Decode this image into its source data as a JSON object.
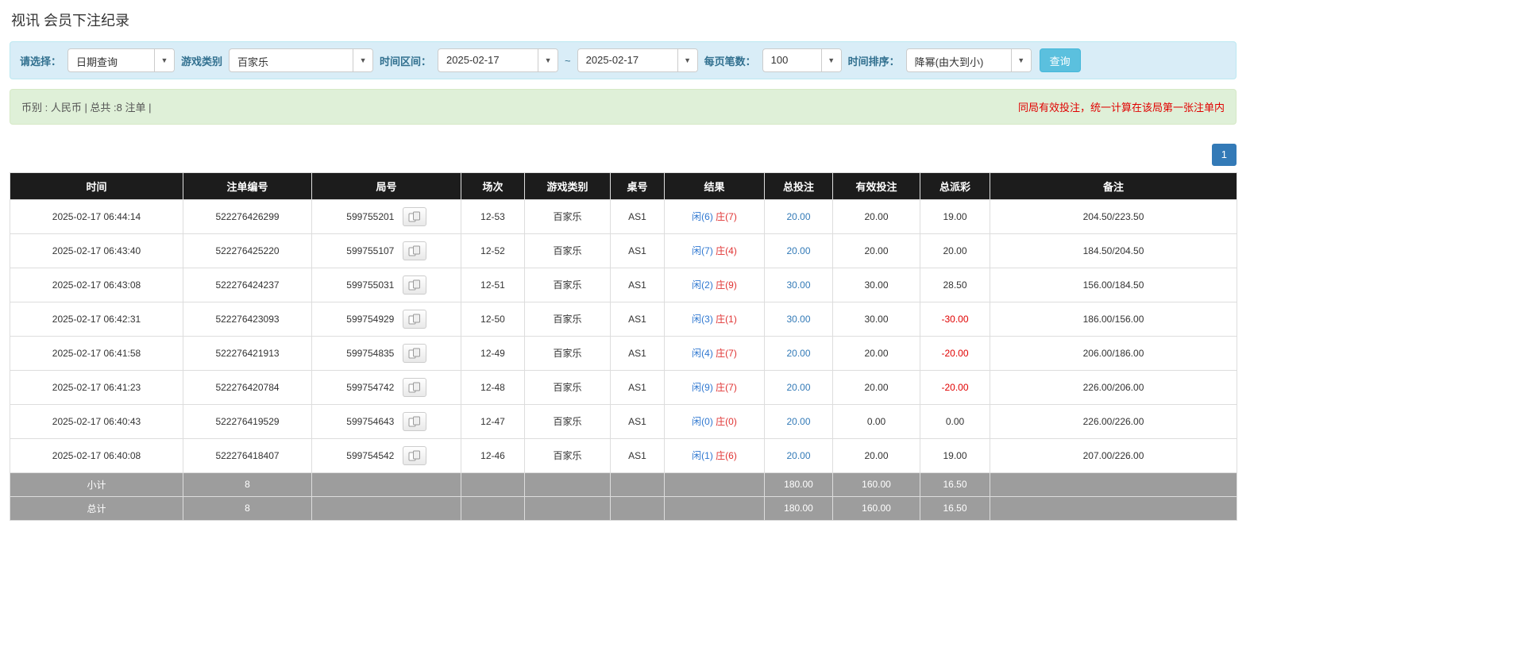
{
  "page": {
    "title": "视讯 会员下注纪录"
  },
  "filters": {
    "select_label": "请选择：",
    "query_type": "日期查询",
    "game_type_label": "游戏类别",
    "game_type": "百家乐",
    "date_range_label": "时间区间：",
    "date_from": "2025-02-17",
    "range_separator": "~",
    "date_to": "2025-02-17",
    "page_size_label": "每页笔数：",
    "page_size": "100",
    "sort_label": "时间排序：",
    "sort_order": "降幂(由大到小)",
    "search_button": "查询",
    "caret": "▼"
  },
  "summary": {
    "info": "币别 : 人民币 | 总共 :8 注单 |",
    "notice": "同局有效投注，统一计算在该局第一张注单内"
  },
  "pagination": {
    "current_page": "1"
  },
  "table": {
    "headers": [
      "时间",
      "注单编号",
      "局号",
      "场次",
      "游戏类别",
      "桌号",
      "结果",
      "总投注",
      "有效投注",
      "总派彩",
      "备注"
    ],
    "rows": [
      {
        "time": "2025-02-17 06:44:14",
        "bet_id": "522276426299",
        "round_id": "599755201",
        "session": "12-53",
        "game": "百家乐",
        "table_no": "AS1",
        "result_player": "闲(6)",
        "result_banker": "庄(7)",
        "total_bet": "20.00",
        "valid_bet": "20.00",
        "payout": "19.00",
        "note": "204.50/223.50"
      },
      {
        "time": "2025-02-17 06:43:40",
        "bet_id": "522276425220",
        "round_id": "599755107",
        "session": "12-52",
        "game": "百家乐",
        "table_no": "AS1",
        "result_player": "闲(7)",
        "result_banker": "庄(4)",
        "total_bet": "20.00",
        "valid_bet": "20.00",
        "payout": "20.00",
        "note": "184.50/204.50"
      },
      {
        "time": "2025-02-17 06:43:08",
        "bet_id": "522276424237",
        "round_id": "599755031",
        "session": "12-51",
        "game": "百家乐",
        "table_no": "AS1",
        "result_player": "闲(2)",
        "result_banker": "庄(9)",
        "total_bet": "30.00",
        "valid_bet": "30.00",
        "payout": "28.50",
        "note": "156.00/184.50"
      },
      {
        "time": "2025-02-17 06:42:31",
        "bet_id": "522276423093",
        "round_id": "599754929",
        "session": "12-50",
        "game": "百家乐",
        "table_no": "AS1",
        "result_player": "闲(3)",
        "result_banker": "庄(1)",
        "total_bet": "30.00",
        "valid_bet": "30.00",
        "payout": "-30.00",
        "note": "186.00/156.00"
      },
      {
        "time": "2025-02-17 06:41:58",
        "bet_id": "522276421913",
        "round_id": "599754835",
        "session": "12-49",
        "game": "百家乐",
        "table_no": "AS1",
        "result_player": "闲(4)",
        "result_banker": "庄(7)",
        "total_bet": "20.00",
        "valid_bet": "20.00",
        "payout": "-20.00",
        "note": "206.00/186.00"
      },
      {
        "time": "2025-02-17 06:41:23",
        "bet_id": "522276420784",
        "round_id": "599754742",
        "session": "12-48",
        "game": "百家乐",
        "table_no": "AS1",
        "result_player": "闲(9)",
        "result_banker": "庄(7)",
        "total_bet": "20.00",
        "valid_bet": "20.00",
        "payout": "-20.00",
        "note": "226.00/206.00"
      },
      {
        "time": "2025-02-17 06:40:43",
        "bet_id": "522276419529",
        "round_id": "599754643",
        "session": "12-47",
        "game": "百家乐",
        "table_no": "AS1",
        "result_player": "闲(0)",
        "result_banker": "庄(0)",
        "total_bet": "20.00",
        "valid_bet": "0.00",
        "payout": "0.00",
        "note": "226.00/226.00"
      },
      {
        "time": "2025-02-17 06:40:08",
        "bet_id": "522276418407",
        "round_id": "599754542",
        "session": "12-46",
        "game": "百家乐",
        "table_no": "AS1",
        "result_player": "闲(1)",
        "result_banker": "庄(6)",
        "total_bet": "20.00",
        "valid_bet": "20.00",
        "payout": "19.00",
        "note": "207.00/226.00"
      }
    ],
    "subtotal": {
      "label": "小计",
      "count": "8",
      "total_bet": "180.00",
      "valid_bet": "160.00",
      "payout": "16.50"
    },
    "total": {
      "label": "总计",
      "count": "8",
      "total_bet": "180.00",
      "valid_bet": "160.00",
      "payout": "16.50"
    }
  },
  "colors": {
    "accent_blue": "#337ab7",
    "player_blue": "#2e77d0",
    "banker_red": "#e03333",
    "negative_red": "#e00000",
    "search_button_blue": "#5bc0de",
    "filter_bar_bg": "#d9edf7",
    "summary_bar_bg": "#dff0d8",
    "header_bg": "#1c1c1c",
    "footer_row_bg": "#9d9d9d"
  }
}
